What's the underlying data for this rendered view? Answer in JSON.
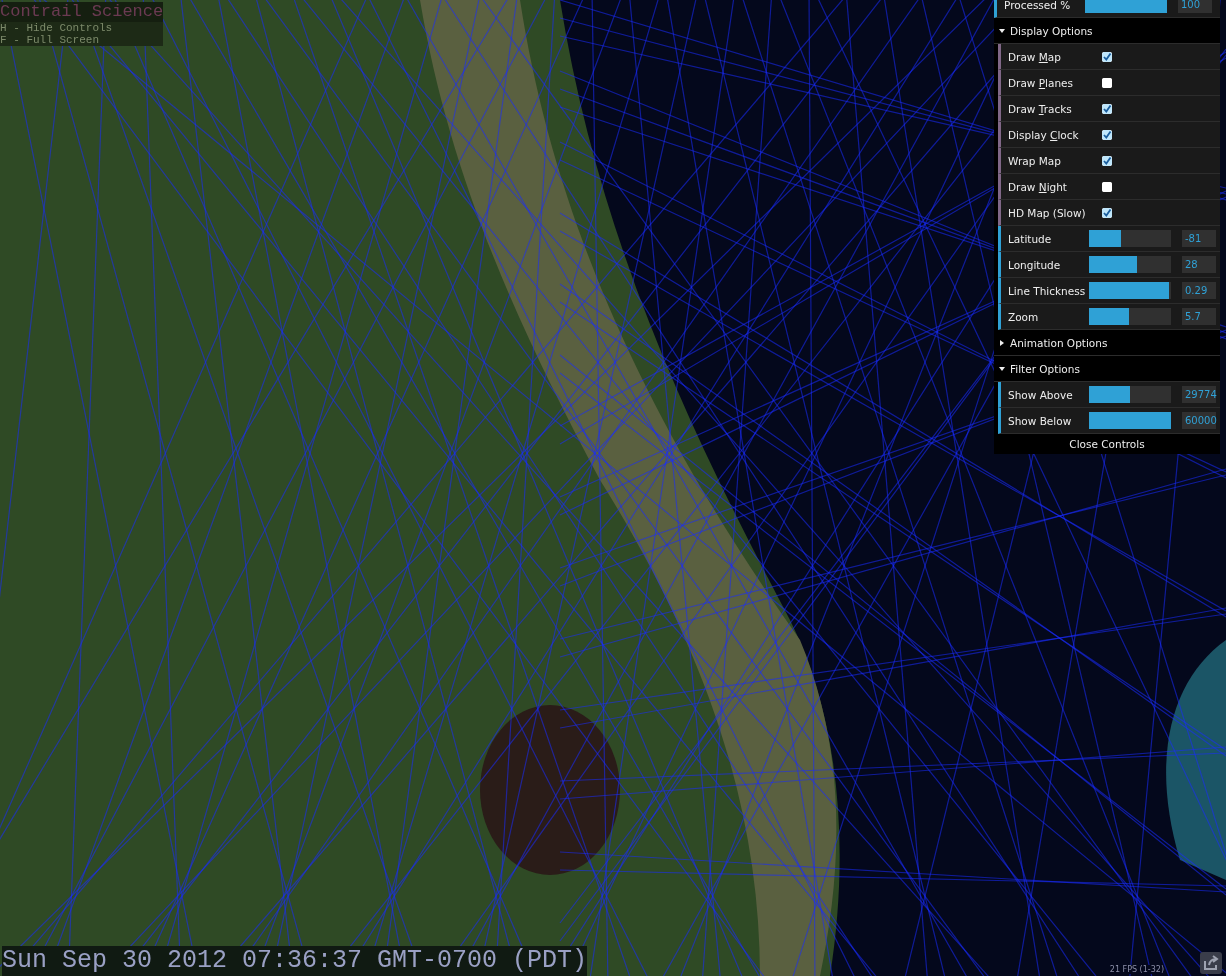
{
  "overlay": {
    "title": "Contrail Science",
    "hints": [
      "H - Hide Controls",
      "F - Full Screen"
    ],
    "clock": "Sun Sep 30 2012 07:36:37 GMT-0700 (PDT)",
    "fps": "21 FPS (1-32)"
  },
  "controls": {
    "top_rows": [
      {
        "kind": "slider",
        "label": "Processed %",
        "level": 1.0,
        "value": "100"
      }
    ],
    "folders": [
      {
        "title": "Display Options",
        "expanded": true,
        "rows": [
          {
            "kind": "checkbox",
            "label": "Draw ",
            "hotkey": "M",
            "label_rest": "ap",
            "checked": true
          },
          {
            "kind": "checkbox",
            "label": "Draw ",
            "hotkey": "P",
            "label_rest": "lanes",
            "checked": false
          },
          {
            "kind": "checkbox",
            "label": "Draw ",
            "hotkey": "T",
            "label_rest": "racks",
            "checked": true
          },
          {
            "kind": "checkbox",
            "label": "Display ",
            "hotkey": "C",
            "label_rest": "lock",
            "checked": true
          },
          {
            "kind": "checkbox",
            "label": "Wrap Map",
            "checked": true
          },
          {
            "kind": "checkbox",
            "label": "Draw ",
            "hotkey": "N",
            "label_rest": "ight",
            "checked": false
          },
          {
            "kind": "checkbox",
            "label": "HD Map (Slow)",
            "checked": true
          },
          {
            "kind": "slider",
            "label": "Latitude",
            "level": 0.39,
            "value": "-81"
          },
          {
            "kind": "slider",
            "label": "Longitude",
            "level": 0.58,
            "value": "28"
          },
          {
            "kind": "slider",
            "label": "Line Thickness",
            "level": 0.98,
            "value": "0.29"
          },
          {
            "kind": "slider",
            "label": "Zoom",
            "level": 0.49,
            "value": "5.7"
          }
        ]
      },
      {
        "title": "Animation Options",
        "expanded": false
      },
      {
        "title": "Filter Options",
        "expanded": true,
        "rows": [
          {
            "kind": "slider",
            "label": "Show Above",
            "level": 0.5,
            "value": "29774"
          },
          {
            "kind": "slider",
            "label": "Show Below",
            "level": 1.0,
            "value": "60000"
          }
        ]
      }
    ],
    "close_label": "Close Controls"
  }
}
